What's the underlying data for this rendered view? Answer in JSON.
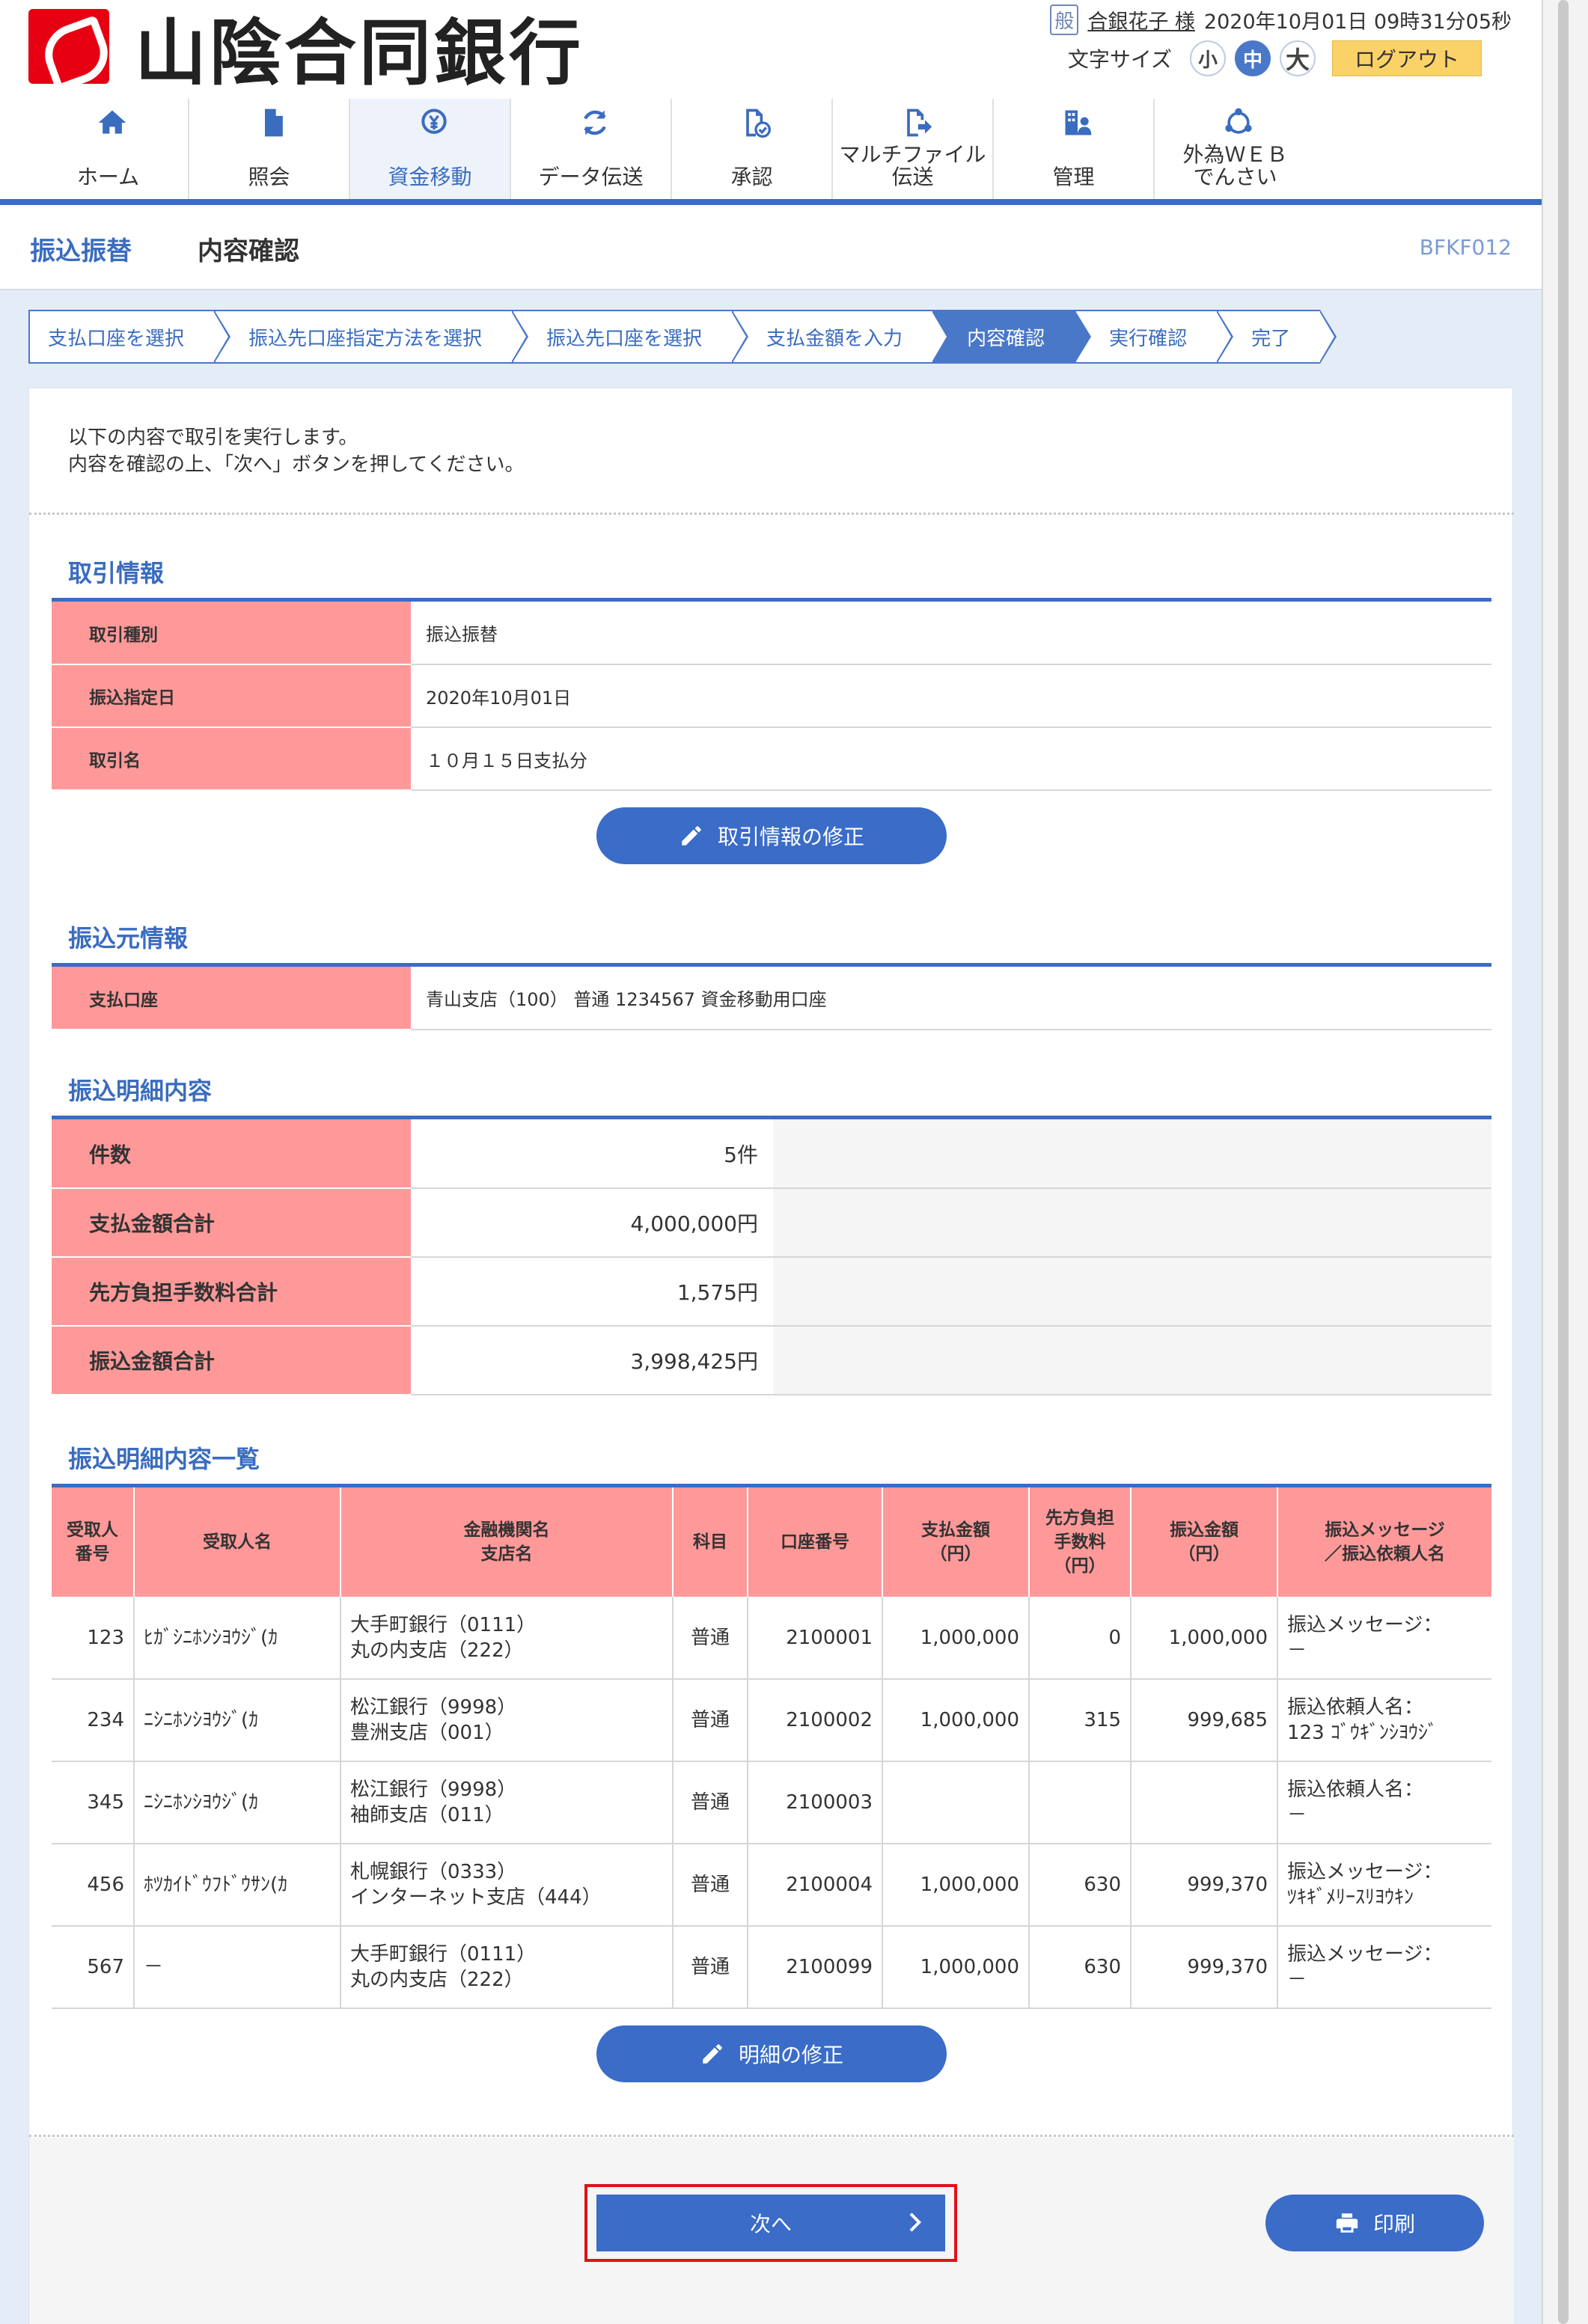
{
  "header": {
    "bank_name": "山陰合同銀行",
    "user_badge": "般",
    "user_name": "合銀花子 様",
    "datetime": "2020年10月01日 09時31分05秒",
    "font_size_label": "文字サイズ",
    "font_small": "小",
    "font_medium": "中",
    "font_large": "大",
    "logout": "ログアウト"
  },
  "nav": {
    "items": [
      {
        "label": "ホーム"
      },
      {
        "label": "照会"
      },
      {
        "label": "資金移動"
      },
      {
        "label": "データ伝送"
      },
      {
        "label": "承認"
      },
      {
        "label": "マルチファイル\n伝送"
      },
      {
        "label": "管理"
      },
      {
        "label": "外為ＷＥＢ\nでんさい"
      }
    ]
  },
  "page": {
    "title": "振込振替",
    "subtitle": "内容確認",
    "code": "BFKF012"
  },
  "steps": [
    "支払口座を選択",
    "振込先口座指定方法を選択",
    "振込先口座を選択",
    "支払金額を入力",
    "内容確認",
    "実行確認",
    "完了"
  ],
  "intro": {
    "line1": "以下の内容で取引を実行します。",
    "line2": "内容を確認の上、「次へ」ボタンを押してください。"
  },
  "transaction": {
    "title": "取引情報",
    "rows": [
      {
        "key": "取引種別",
        "value": "振込振替"
      },
      {
        "key": "振込指定日",
        "value": "2020年10月01日"
      },
      {
        "key": "取引名",
        "value": "１０月１５日支払分"
      }
    ],
    "edit_button": "取引情報の修正"
  },
  "source": {
    "title": "振込元情報",
    "key": "支払口座",
    "value": "青山支店（100） 普通 1234567 資金移動用口座"
  },
  "summary": {
    "title": "振込明細内容",
    "rows": [
      {
        "key": "件数",
        "value": "5件"
      },
      {
        "key": "支払金額合計",
        "value": "4,000,000円"
      },
      {
        "key": "先方負担手数料合計",
        "value": "1,575円"
      },
      {
        "key": "振込金額合計",
        "value": "3,998,425円"
      }
    ]
  },
  "details": {
    "title": "振込明細内容一覧",
    "headers": [
      "受取人\n番号",
      "受取人名",
      "金融機関名\n支店名",
      "科目",
      "口座番号",
      "支払金額\n（円）",
      "先方負担\n手数料\n（円）",
      "振込金額\n（円）",
      "振込メッセージ\n／振込依頼人名"
    ],
    "rows": [
      {
        "no": "123",
        "name": "ﾋｶﾞｼﾆﾎﾝｼﾖｳｼﾞ(ｶ",
        "bank": "大手町銀行（0111）\n丸の内支店（222）",
        "type": "普通",
        "account": "2100001",
        "pay": "1,000,000",
        "fee": "0",
        "amount": "1,000,000",
        "msg": "振込メッセージ：\n－"
      },
      {
        "no": "234",
        "name": "ﾆｼﾆﾎﾝｼﾖｳｼﾞ(ｶ",
        "bank": "松江銀行（9998）\n豊洲支店（001）",
        "type": "普通",
        "account": "2100002",
        "pay": "1,000,000",
        "fee": "315",
        "amount": "999,685",
        "msg": "振込依頼人名：\n123 ｺﾞｳｷﾞﾝｼﾖｳｼﾞ"
      },
      {
        "no": "345",
        "name": "ﾆｼﾆﾎﾝｼﾖｳｼﾞ(ｶ",
        "bank": "松江銀行（9998）\n袖師支店（011）",
        "type": "普通",
        "account": "2100003",
        "pay": "",
        "fee": "",
        "amount": "",
        "msg": "振込依頼人名：\n－"
      },
      {
        "no": "456",
        "name": "ﾎﾂｶｲﾄﾞｳﾌﾄﾞｳｻﾝ(ｶ",
        "bank": "札幌銀行（0333）\nインターネット支店（444）",
        "type": "普通",
        "account": "2100004",
        "pay": "1,000,000",
        "fee": "630",
        "amount": "999,370",
        "msg": "振込メッセージ：\nﾂｷｷﾞﾒﾘｰｽﾘﾖｳｷﾝ"
      },
      {
        "no": "567",
        "name": "－",
        "bank": "大手町銀行（0111）\n丸の内支店（222）",
        "type": "普通",
        "account": "2100099",
        "pay": "1,000,000",
        "fee": "630",
        "amount": "999,370",
        "msg": "振込メッセージ：\n－"
      }
    ],
    "edit_button": "明細の修正"
  },
  "footer": {
    "next": "次へ",
    "print": "印刷"
  },
  "colors": {
    "accent": "#3a6cbf",
    "header_cell": "#ff9999",
    "highlight": "#e0101a",
    "logout": "#fbd268"
  }
}
